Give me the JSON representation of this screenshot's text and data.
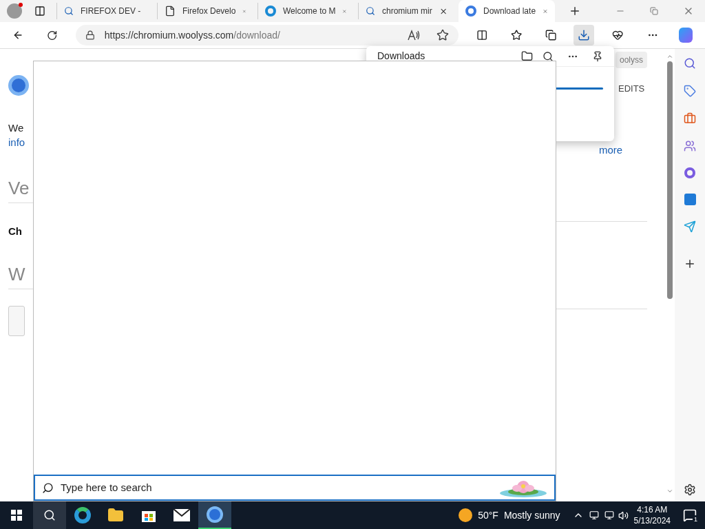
{
  "tabs": [
    {
      "label": "FIREFOX DEV -",
      "kind": "search",
      "selected": false
    },
    {
      "label": "Firefox Develo",
      "kind": "page",
      "selected": false
    },
    {
      "label": "Welcome to M",
      "kind": "edge",
      "selected": false
    },
    {
      "label": "chromium mir",
      "kind": "search",
      "selected": false
    },
    {
      "label": "Download late",
      "kind": "chromium",
      "selected": true
    }
  ],
  "address_bar": {
    "url_host": "https://chromium.woolyss.com",
    "url_path": "/download/"
  },
  "toolbar": {
    "downloads_active": true
  },
  "page": {
    "left_fragments": [
      {
        "text": "We",
        "kind": "body"
      },
      {
        "text": "info",
        "kind": "link"
      },
      {
        "text": "Ve",
        "kind": "heading"
      },
      {
        "text": "Ch",
        "kind": "bold"
      },
      {
        "text": "W",
        "kind": "heading"
      }
    ],
    "site_chip": "oolyss",
    "nav_item": "EDITS",
    "link": "more"
  },
  "downloads_panel": {
    "title": "Downloads",
    "progress": {
      "level": 1
    }
  },
  "search_popup": {
    "placeholder": "Type here to search"
  },
  "taskbar": {
    "apps": [
      {
        "kind": "edge",
        "selected": false
      },
      {
        "kind": "explorer",
        "selected": false
      },
      {
        "kind": "store",
        "selected": false
      },
      {
        "kind": "mail",
        "selected": false
      },
      {
        "kind": "firefox",
        "selected": true
      }
    ],
    "weather": {
      "temp": "50°F",
      "condition": "Mostly sunny"
    },
    "time": "4:16 AM",
    "date": "5/13/2024",
    "notifications": "1"
  }
}
